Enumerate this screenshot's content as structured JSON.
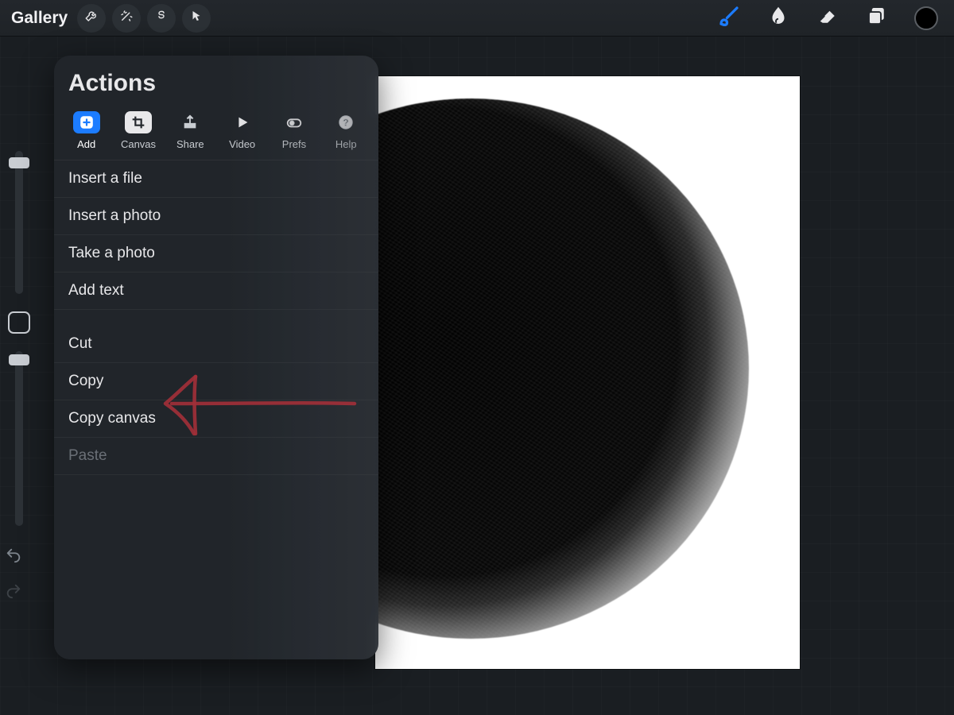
{
  "topbar": {
    "gallery_label": "Gallery"
  },
  "actions": {
    "title": "Actions",
    "tabs": [
      {
        "key": "add",
        "label": "Add",
        "active": true
      },
      {
        "key": "canvas",
        "label": "Canvas",
        "active": false
      },
      {
        "key": "share",
        "label": "Share",
        "active": false
      },
      {
        "key": "video",
        "label": "Video",
        "active": false
      },
      {
        "key": "prefs",
        "label": "Prefs",
        "active": false
      },
      {
        "key": "help",
        "label": "Help",
        "active": false
      }
    ],
    "group1": [
      "Insert a file",
      "Insert a photo",
      "Take a photo",
      "Add text"
    ],
    "group2": [
      {
        "label": "Cut",
        "disabled": false
      },
      {
        "label": "Copy",
        "disabled": false
      },
      {
        "label": "Copy canvas",
        "disabled": false
      },
      {
        "label": "Paste",
        "disabled": true
      }
    ]
  },
  "annotation": {
    "target": "Copy canvas",
    "color": "#a33038"
  },
  "colors": {
    "accent": "#1c7cff",
    "panel": "#22262b",
    "swatch": "#000000"
  }
}
